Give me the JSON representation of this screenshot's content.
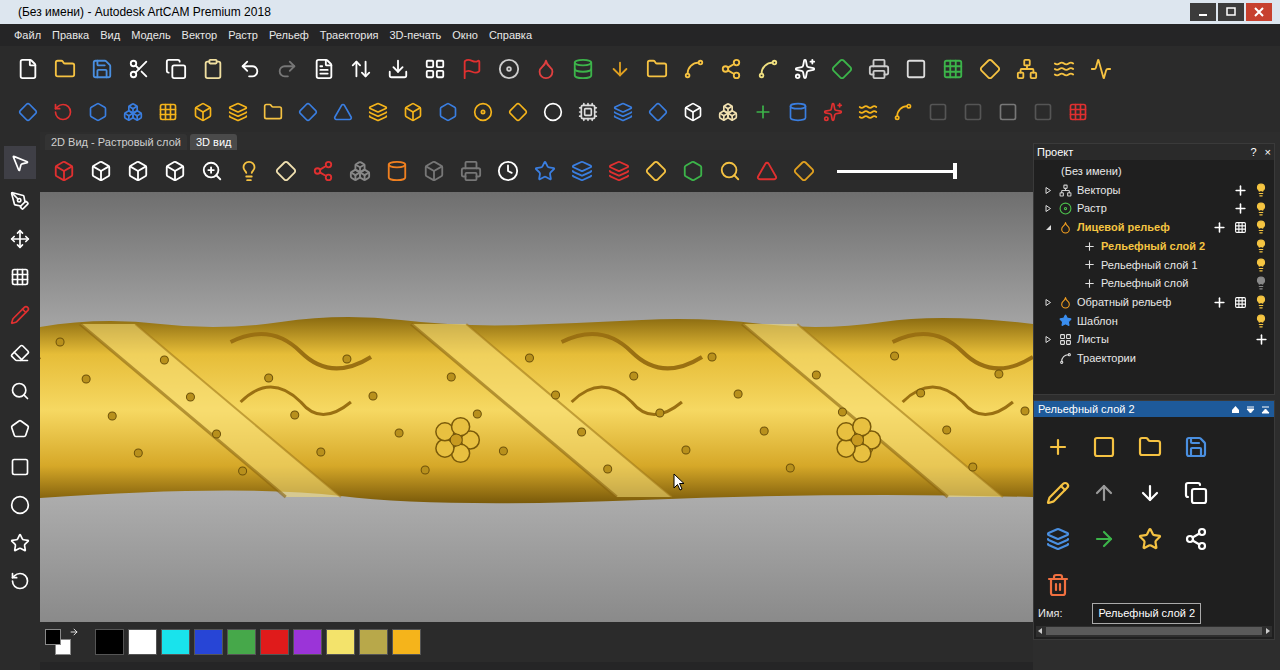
{
  "window": {
    "title": "(Без имени) - Autodesk ArtCAM Premium 2018"
  },
  "menu": [
    "Файл",
    "Правка",
    "Вид",
    "Модель",
    "Вектор",
    "Растр",
    "Рельеф",
    "Траектория",
    "3D-печать",
    "Окно",
    "Справка"
  ],
  "view_tabs": [
    {
      "label": "2D Вид - Растровый слой",
      "selected": false
    },
    {
      "label": "3D вид",
      "selected": true
    }
  ],
  "view_slider": {
    "level": 1
  },
  "project_panel": {
    "title": "Проект",
    "help": "?",
    "close": "×",
    "items": [
      {
        "label": "(Без имени)",
        "level": 0,
        "kind": "root",
        "selected": false
      },
      {
        "label": "Векторы",
        "level": 1,
        "kind": "vectors",
        "expanded": false,
        "add": true,
        "grid": false,
        "visible": true,
        "selected": false
      },
      {
        "label": "Растр",
        "level": 1,
        "kind": "raster",
        "expanded": false,
        "add": true,
        "grid": false,
        "visible": true,
        "selected": false
      },
      {
        "label": "Лицевой рельеф",
        "level": 1,
        "kind": "relief",
        "expanded": true,
        "add": true,
        "grid": true,
        "visible": true,
        "selected": true
      },
      {
        "label": "Рельефный слой 2",
        "level": 2,
        "kind": "layer",
        "visible": true,
        "selected": true
      },
      {
        "label": "Рельефный слой 1",
        "level": 2,
        "kind": "layer",
        "visible": true,
        "selected": false
      },
      {
        "label": "Рельефный слой",
        "level": 2,
        "kind": "layer",
        "visible": false,
        "selected": false
      },
      {
        "label": "Обратный рельеф",
        "level": 1,
        "kind": "relief",
        "expanded": false,
        "add": true,
        "grid": true,
        "visible": true,
        "selected": false
      },
      {
        "label": "Шаблон",
        "level": 1,
        "kind": "template",
        "visible": true,
        "selected": false
      },
      {
        "label": "Листы",
        "level": 1,
        "kind": "sheets",
        "expanded": false,
        "add": true,
        "selected": false
      },
      {
        "label": "Траектории",
        "level": 1,
        "kind": "toolpaths",
        "selected": false
      }
    ]
  },
  "layer_panel": {
    "title": "Рельефный слой 2",
    "name_label": "Имя:",
    "name_value": "Рельефный слой 2"
  },
  "palette": {
    "current": {
      "fg": "#000000",
      "bg": "#ffffff"
    },
    "swatches": [
      {
        "color": "#000000"
      },
      {
        "color": "#ffffff"
      },
      {
        "color": "#19e3ec"
      },
      {
        "color": "#2745d6"
      },
      {
        "color": "#46a84a"
      },
      {
        "color": "#e01b1b"
      },
      {
        "color": "#9b34d8"
      },
      {
        "color": "#f3e36b"
      },
      {
        "color": "#b8a84a"
      },
      {
        "color": "#f5b41b"
      }
    ]
  }
}
